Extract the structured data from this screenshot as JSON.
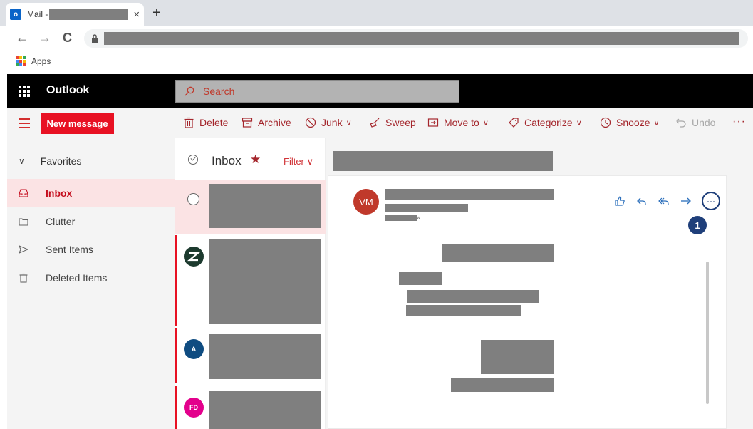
{
  "browser": {
    "tab_title": "Mail - ",
    "tab_close": "×",
    "new_tab": "+",
    "back": "←",
    "forward": "→",
    "reload": "C",
    "bookmarks_apps": "Apps"
  },
  "outlook": {
    "brand": "Outlook",
    "search_placeholder": "Search"
  },
  "command_bar": {
    "new_message": "New message",
    "delete": "Delete",
    "archive": "Archive",
    "junk": "Junk",
    "sweep": "Sweep",
    "move_to": "Move to",
    "categorize": "Categorize",
    "snooze": "Snooze",
    "undo": "Undo",
    "more": "···",
    "chevron": "∨"
  },
  "nav": {
    "favorites": "Favorites",
    "chevron": "∨",
    "items": [
      {
        "label": "Inbox"
      },
      {
        "label": "Clutter"
      },
      {
        "label": "Sent Items"
      },
      {
        "label": "Deleted Items"
      }
    ]
  },
  "message_list": {
    "title": "Inbox",
    "star": "★",
    "filter": "Filter ∨",
    "avatars": [
      {
        "initials": "",
        "color": "#1c3a2e"
      },
      {
        "initials": "A",
        "color": "#0f4c81"
      },
      {
        "initials": "FD",
        "color": "#e3008c"
      }
    ]
  },
  "reading_pane": {
    "sender_initials": "VM",
    "sender_color": "#c0392b",
    "expand": "»",
    "more_button": "···",
    "callout_number": "1"
  },
  "colors": {
    "accent": "#e81123",
    "brand_red": "#a4262c",
    "header": "#000000",
    "callout": "#1f3f7a"
  }
}
